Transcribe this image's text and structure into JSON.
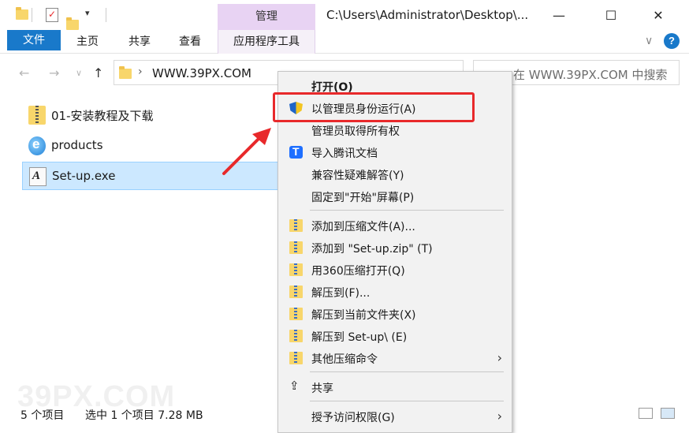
{
  "titlebar": {
    "context_tab_header": "管理",
    "title": "C:\\Users\\Administrator\\Desktop\\...",
    "minimize": "—",
    "maximize": "☐",
    "close": "✕"
  },
  "ribbon": {
    "tabs": [
      {
        "label": "文件"
      },
      {
        "label": "主页"
      },
      {
        "label": "共享"
      },
      {
        "label": "查看"
      },
      {
        "label": "应用程序工具"
      }
    ],
    "help": "?"
  },
  "nav": {
    "address": "WWW.39PX.COM",
    "search_placeholder": "在 WWW.39PX.COM 中搜索"
  },
  "files": [
    {
      "name": "01-安装教程及下载",
      "icon": "zip-folder-icon"
    },
    {
      "name": "products",
      "icon": "ie-icon"
    },
    {
      "name": "Set-up.exe",
      "icon": "exe-icon",
      "selected": true
    }
  ],
  "status": {
    "count": "5 个项目",
    "selection": "选中 1 个项目  7.28 MB"
  },
  "watermark": "39PX.COM",
  "context_menu": {
    "items": [
      {
        "label": "打开(O)",
        "bold": true
      },
      {
        "label": "以管理员身份运行(A)",
        "icon": "shield-icon",
        "highlighted": true
      },
      {
        "label": "管理员取得所有权"
      },
      {
        "label": "导入腾讯文档",
        "icon": "tencent-docs-icon"
      },
      {
        "label": "兼容性疑难解答(Y)"
      },
      {
        "label": "固定到\"开始\"屏幕(P)"
      },
      {
        "label": "添加到压缩文件(A)...",
        "icon": "archive-icon"
      },
      {
        "label": "添加到 \"Set-up.zip\" (T)",
        "icon": "archive-icon"
      },
      {
        "label": "用360压缩打开(Q)",
        "icon": "archive-icon"
      },
      {
        "label": "解压到(F)...",
        "icon": "archive-icon"
      },
      {
        "label": "解压到当前文件夹(X)",
        "icon": "archive-icon"
      },
      {
        "label": "解压到 Set-up\\ (E)",
        "icon": "archive-icon"
      },
      {
        "label": "其他压缩命令",
        "icon": "archive-icon",
        "submenu": true
      },
      {
        "label": "共享",
        "icon": "share-icon"
      },
      {
        "label": "授予访问权限(G)",
        "submenu": true
      }
    ]
  },
  "colors": {
    "accent": "#1979ca",
    "context_tab": "#e8d3f3",
    "selection": "#cce8ff",
    "annotation_red": "#e8292b"
  }
}
